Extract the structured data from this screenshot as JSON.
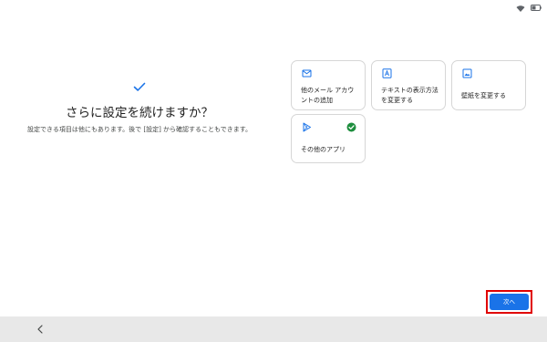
{
  "status_bar": {
    "icons": [
      "wifi-icon",
      "battery-icon"
    ]
  },
  "main": {
    "check_icon": "checkmark-icon",
    "title": "さらに設定を続けますか？",
    "subtitle": "設定できる項目は他にもあります。後で [設定] から確認することもできます。"
  },
  "cards": [
    {
      "icon": "mail-icon",
      "label": "他のメール アカウントの追加",
      "checked": false
    },
    {
      "icon": "text-display-icon",
      "label": "テキストの表示方法を変更する",
      "checked": false
    },
    {
      "icon": "wallpaper-icon",
      "label": "壁紙を変更する",
      "checked": false
    },
    {
      "icon": "play-store-icon",
      "label": "その他のアプリ",
      "checked": true
    }
  ],
  "footer": {
    "next_label": "次へ"
  },
  "colors": {
    "accent": "#1a73e8",
    "check_green": "#1e8e3e",
    "highlight_red": "#e00000",
    "nav_bar": "#e8e8e8"
  },
  "nav_bar": {
    "back_icon": "back-arrow-icon"
  }
}
